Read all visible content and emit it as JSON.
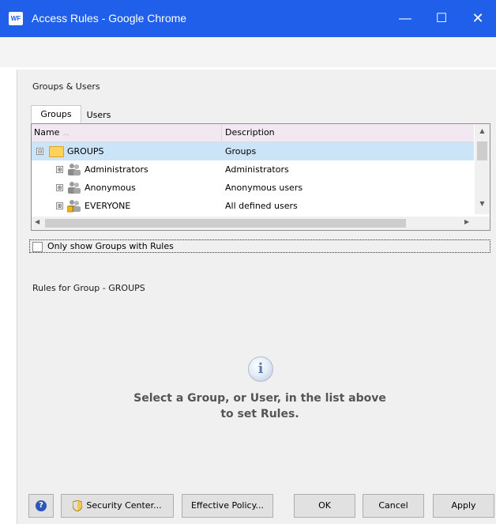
{
  "window": {
    "app_icon_text": "WF",
    "title": "Access Rules - Google Chrome",
    "minimize_glyph": "—",
    "maximize_glyph": "☐",
    "close_glyph": "✕"
  },
  "dialog": {
    "section_title": "Groups & Users",
    "tabs": [
      {
        "label": "Groups",
        "active": true
      },
      {
        "label": "Users",
        "active": false
      }
    ],
    "grid": {
      "columns": [
        "Name",
        "Description"
      ],
      "rows": [
        {
          "name": "GROUPS",
          "description": "Groups",
          "expander": "⊟",
          "icon": "folder-icon",
          "selected": true
        },
        {
          "name": "Administrators",
          "description": "Administrators",
          "expander": "⊞",
          "icon": "group-icon",
          "selected": false
        },
        {
          "name": "Anonymous",
          "description": "Anonymous users",
          "expander": "⊞",
          "icon": "group-icon",
          "selected": false
        },
        {
          "name": "EVERYONE",
          "description": "All defined users",
          "expander": "⊞",
          "icon": "group-lock-icon",
          "selected": false
        }
      ]
    },
    "checkbox": {
      "label": "Only show Groups with Rules",
      "checked": false
    },
    "rules_title": "Rules for Group - GROUPS",
    "info": {
      "icon_glyph": "i",
      "line1": "Select a Group, or User, in the list above",
      "line2": "to set Rules."
    },
    "buttons": {
      "help": "?",
      "security_center": "Security Center...",
      "effective_policy": "Effective Policy...",
      "ok": "OK",
      "cancel": "Cancel",
      "apply": "Apply"
    }
  },
  "colors": {
    "titlebar": "#1f5fe9",
    "selection": "#cce4f7",
    "header": "#f2e8f2",
    "dialog_bg": "#f0f0f0"
  }
}
